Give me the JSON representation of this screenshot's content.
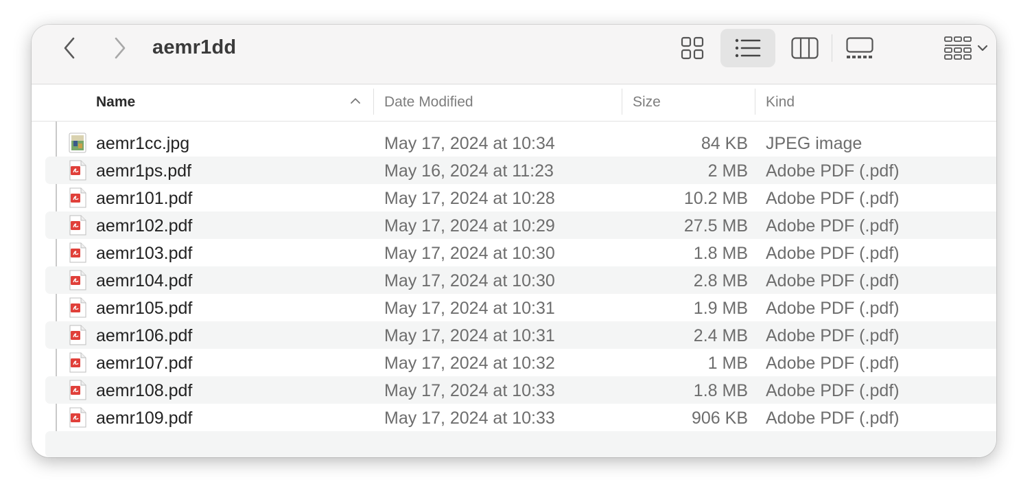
{
  "window": {
    "title": "aemr1dd"
  },
  "toolbar": {
    "back_icon": "chevron-left-icon",
    "forward_icon": "chevron-right-icon",
    "views": [
      {
        "name": "icon-view",
        "icon": "grid-icon",
        "active": false
      },
      {
        "name": "list-view",
        "icon": "list-icon",
        "active": true
      },
      {
        "name": "column-view",
        "icon": "columns-icon",
        "active": false
      },
      {
        "name": "gallery-view",
        "icon": "gallery-icon",
        "active": false
      }
    ],
    "group_icon": "group-grid-icon",
    "group_chevron_icon": "chevron-down-icon"
  },
  "columns": {
    "name": "Name",
    "date": "Date Modified",
    "size": "Size",
    "kind": "Kind",
    "sort_icon": "chevron-up-icon"
  },
  "colors": {
    "pdf_icon_red": "#e0403a",
    "active_view_bg": "#e4e4e4",
    "alt_row_bg": "#f4f5f5"
  },
  "files": [
    {
      "name": "aemr1cc.jpg",
      "date": "May 17, 2024 at 10:34",
      "size": "84 KB",
      "kind": "JPEG image",
      "icon": "jpeg-image-icon"
    },
    {
      "name": "aemr1ps.pdf",
      "date": "May 16, 2024 at 11:23",
      "size": "2 MB",
      "kind": "Adobe PDF (.pdf)",
      "icon": "pdf-file-icon"
    },
    {
      "name": "aemr101.pdf",
      "date": "May 17, 2024 at 10:28",
      "size": "10.2 MB",
      "kind": "Adobe PDF (.pdf)",
      "icon": "pdf-file-icon"
    },
    {
      "name": "aemr102.pdf",
      "date": "May 17, 2024 at 10:29",
      "size": "27.5 MB",
      "kind": "Adobe PDF (.pdf)",
      "icon": "pdf-file-icon"
    },
    {
      "name": "aemr103.pdf",
      "date": "May 17, 2024 at 10:30",
      "size": "1.8 MB",
      "kind": "Adobe PDF (.pdf)",
      "icon": "pdf-file-icon"
    },
    {
      "name": "aemr104.pdf",
      "date": "May 17, 2024 at 10:30",
      "size": "2.8 MB",
      "kind": "Adobe PDF (.pdf)",
      "icon": "pdf-file-icon"
    },
    {
      "name": "aemr105.pdf",
      "date": "May 17, 2024 at 10:31",
      "size": "1.9 MB",
      "kind": "Adobe PDF (.pdf)",
      "icon": "pdf-file-icon"
    },
    {
      "name": "aemr106.pdf",
      "date": "May 17, 2024 at 10:31",
      "size": "2.4 MB",
      "kind": "Adobe PDF (.pdf)",
      "icon": "pdf-file-icon"
    },
    {
      "name": "aemr107.pdf",
      "date": "May 17, 2024 at 10:32",
      "size": "1 MB",
      "kind": "Adobe PDF (.pdf)",
      "icon": "pdf-file-icon"
    },
    {
      "name": "aemr108.pdf",
      "date": "May 17, 2024 at 10:33",
      "size": "1.8 MB",
      "kind": "Adobe PDF (.pdf)",
      "icon": "pdf-file-icon"
    },
    {
      "name": "aemr109.pdf",
      "date": "May 17, 2024 at 10:33",
      "size": "906 KB",
      "kind": "Adobe PDF (.pdf)",
      "icon": "pdf-file-icon"
    }
  ]
}
